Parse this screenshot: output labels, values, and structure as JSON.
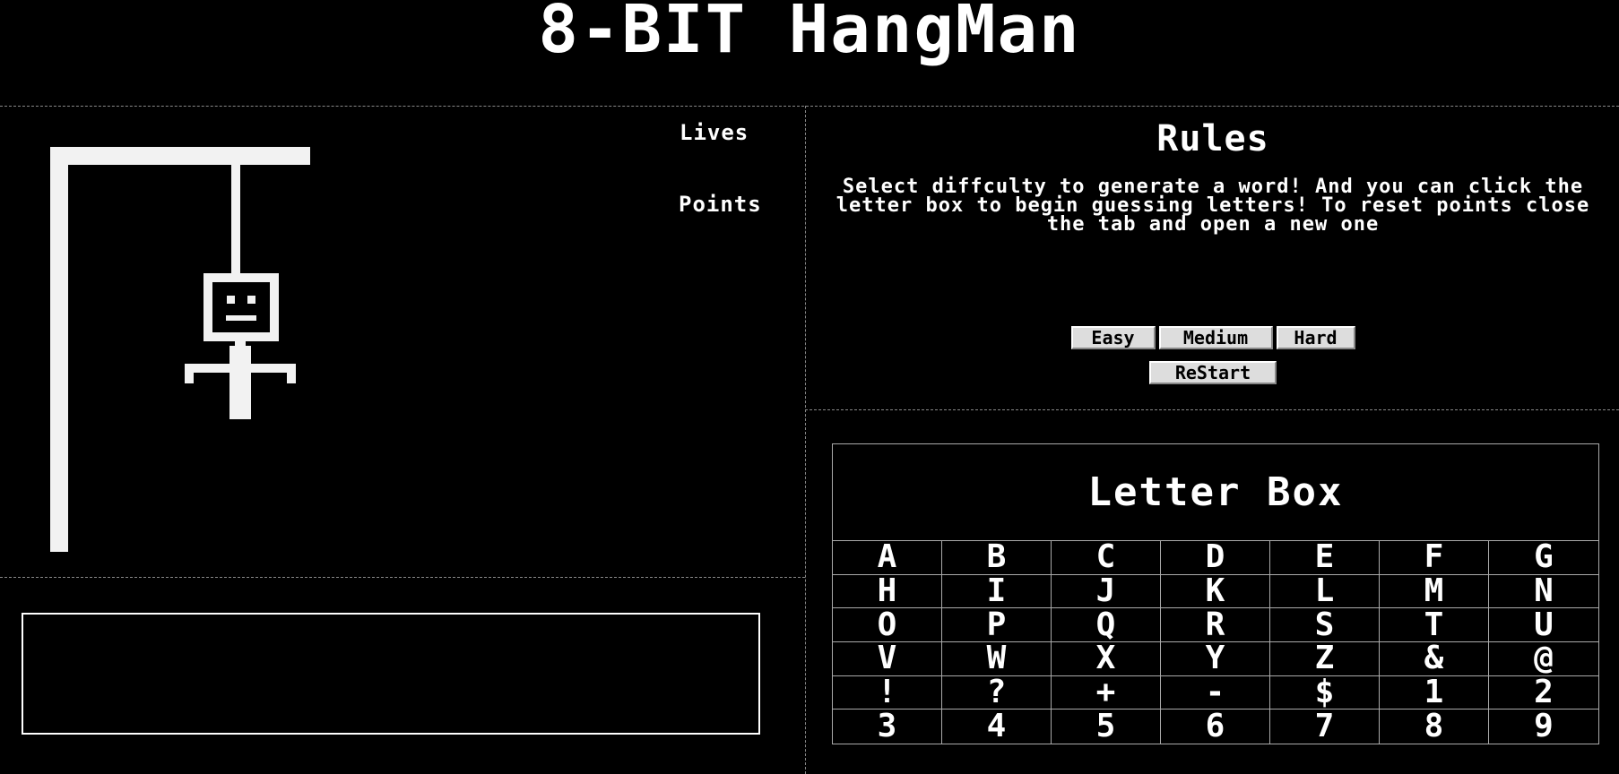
{
  "header": {
    "title": "8-BIT HangMan"
  },
  "stats": {
    "lives_label": "Lives",
    "lives_value": "",
    "points_label": "Points",
    "points_value": ""
  },
  "word": {
    "display": ""
  },
  "rules": {
    "title": "Rules",
    "text": "Select diffculty to generate a word! And you can click the letter box to begin guessing letters! To reset points close the tab and open a new one"
  },
  "buttons": {
    "easy": "Easy",
    "medium": "Medium",
    "hard": "Hard",
    "restart": "ReStart"
  },
  "letter_box": {
    "title": "Letter Box",
    "keys": [
      "A",
      "B",
      "C",
      "D",
      "E",
      "F",
      "G",
      "H",
      "I",
      "J",
      "K",
      "L",
      "M",
      "N",
      "O",
      "P",
      "Q",
      "R",
      "S",
      "T",
      "U",
      "V",
      "W",
      "X",
      "Y",
      "Z",
      "&",
      "@",
      "!",
      "?",
      "+",
      "-",
      "$",
      "1",
      "2",
      "3",
      "4",
      "5",
      "6",
      "7",
      "8",
      "9"
    ]
  },
  "colors": {
    "background": "#000000",
    "foreground": "#ffffff",
    "button": "#dddddd"
  }
}
